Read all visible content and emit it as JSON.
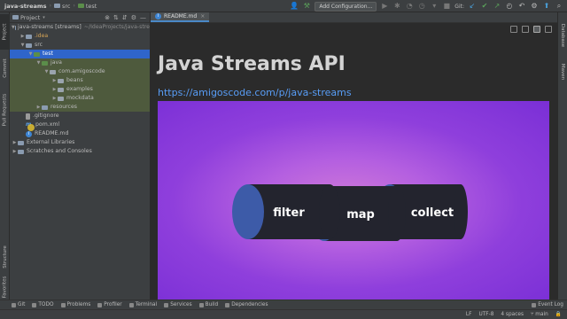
{
  "navbar": {
    "crumbs": [
      "java-streams",
      "src",
      "test"
    ],
    "add_configuration": "Add Configuration...",
    "git_label": "Git:"
  },
  "left_stripe": {
    "tabs": [
      "Project",
      "Commit",
      "Pull Requests",
      "Structure",
      "Favorites"
    ]
  },
  "right_stripe": {
    "tabs": [
      "Database",
      "Maven"
    ]
  },
  "project": {
    "header_label": "Project",
    "tree": [
      {
        "label": "java-streams [streams]",
        "extra": "~/IdeaProjects/java-stre",
        "indent": 0,
        "arrow": "▼",
        "icon": "folder",
        "style": ""
      },
      {
        "label": ".idea",
        "indent": 1,
        "arrow": "▶",
        "icon": "folder",
        "style": "orange"
      },
      {
        "label": "src",
        "indent": 1,
        "arrow": "▼",
        "icon": "folder",
        "style": ""
      },
      {
        "label": "test",
        "indent": 2,
        "arrow": "▼",
        "icon": "green",
        "style": "sel"
      },
      {
        "label": "java",
        "indent": 3,
        "arrow": "▼",
        "icon": "green",
        "style": "hl"
      },
      {
        "label": "com.amigoscode",
        "indent": 4,
        "arrow": "▼",
        "icon": "pkg",
        "style": "hl"
      },
      {
        "label": "beans",
        "indent": 5,
        "arrow": "▶",
        "icon": "pkg",
        "style": "hl"
      },
      {
        "label": "examples",
        "indent": 5,
        "arrow": "▶",
        "icon": "pkg",
        "style": "hl"
      },
      {
        "label": "mockdata",
        "indent": 5,
        "arrow": "▶",
        "icon": "pkg",
        "style": "hl"
      },
      {
        "label": "resources",
        "indent": 3,
        "arrow": "▶",
        "icon": "folder",
        "style": "hl"
      },
      {
        "label": ".gitignore",
        "indent": 1,
        "arrow": "",
        "icon": "file",
        "style": ""
      },
      {
        "label": "pom.xml",
        "indent": 1,
        "arrow": "",
        "icon": "maven",
        "style": ""
      },
      {
        "label": "README.md",
        "indent": 1,
        "arrow": "",
        "icon": "info",
        "style": ""
      },
      {
        "label": "External Libraries",
        "indent": 0,
        "arrow": "▶",
        "icon": "folder",
        "style": ""
      },
      {
        "label": "Scratches and Consoles",
        "indent": 0,
        "arrow": "▶",
        "icon": "folder",
        "style": ""
      }
    ]
  },
  "editor": {
    "tab_label": "README.md",
    "title": "Java Streams API",
    "link": "https://amigoscode.com/p/java-streams",
    "hero": {
      "words": [
        "filter",
        "map",
        "collect"
      ]
    }
  },
  "bottom_tools": [
    "Git",
    "TODO",
    "Problems",
    "Profiler",
    "Terminal",
    "Services",
    "Build",
    "Dependencies"
  ],
  "bottom_right": "Event Log",
  "status": {
    "line_sep": "LF",
    "encoding": "UTF-8",
    "indent": "4 spaces",
    "branch": "main"
  },
  "colors": {
    "accent": "#2f65ca",
    "link": "#589df6",
    "hero_purple": "#8f3fdc",
    "cylinder": "#23242e",
    "cylinder_cap": "#3d5ba8"
  }
}
